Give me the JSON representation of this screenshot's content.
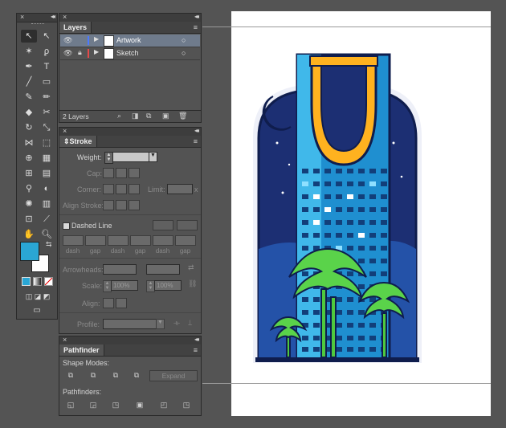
{
  "tools_panel": {
    "collapse": "◂◂",
    "close": "×",
    "fill_color": "#2aa6d4",
    "stroke_color": "#ffffff"
  },
  "layers_panel": {
    "tab": "Layers",
    "menu": "≡",
    "rows": [
      {
        "name": "Artwork",
        "color": "#4a78ff",
        "selected": true
      },
      {
        "name": "Sketch",
        "color": "#e44a4a",
        "selected": false
      }
    ],
    "count": "2 Layers"
  },
  "stroke_panel": {
    "tab": "Stroke",
    "weight_label": "Weight:",
    "cap_label": "Cap:",
    "corner_label": "Corner:",
    "limit_label": "Limit:",
    "limit_unit": "x",
    "align_label": "Align Stroke:",
    "dashed_label": "Dashed Line",
    "dash_labels": [
      "dash",
      "gap",
      "dash",
      "gap",
      "dash",
      "gap"
    ],
    "arrowheads_label": "Arrowheads:",
    "scale_label": "Scale:",
    "scale_value_1": "100%",
    "scale_value_2": "100%",
    "align_label2": "Align:",
    "profile_label": "Profile:"
  },
  "pathfinder_panel": {
    "tab": "Pathfinder",
    "shape_modes_label": "Shape Modes:",
    "expand_label": "Expand",
    "pathfinders_label": "Pathfinders:"
  },
  "artwork": {
    "sky_color": "#1c2f73",
    "tower_color": "#1f8fd0",
    "arch_color": "#ffb21f",
    "palm_color": "#5ad34a",
    "moon_color": "#ffe02a"
  }
}
